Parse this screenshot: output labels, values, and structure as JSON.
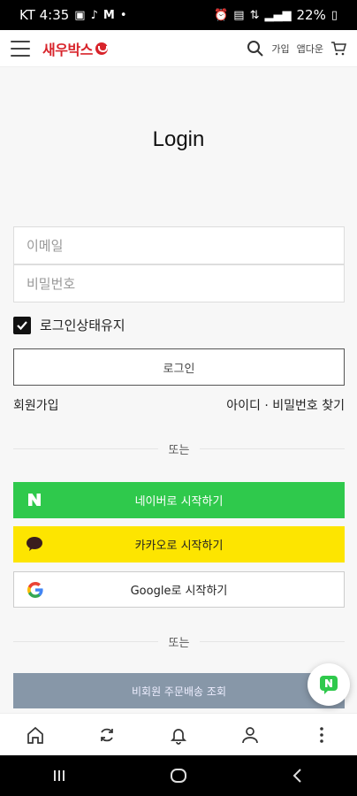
{
  "status_bar": {
    "time": "KT 4:35",
    "battery": "22%"
  },
  "header": {
    "logo_text": "새우박스",
    "join_label": "가입",
    "app_download_label": "앱다운",
    "brand_color": "#d8242b"
  },
  "main": {
    "title": "Login",
    "email_placeholder": "이메일",
    "password_placeholder": "비밀번호",
    "keep_login_label": "로그인상태유지",
    "keep_login_checked": true,
    "login_button": "로그인",
    "signup_link": "회원가입",
    "find_account_link": "아이디 · 비밀번호 찾기",
    "divider_text_1": "또는",
    "naver_button": "네이버로 시작하기",
    "kakao_button": "카카오로 시작하기",
    "google_button": "Google로 시작하기",
    "divider_text_2": "또는",
    "guest_order_button": "비회원 주문배송 조회"
  },
  "colors": {
    "naver": "#2fc94c",
    "kakao": "#fde500",
    "guest_button": "#8797a8"
  },
  "bottom_nav": {
    "items": [
      "home-icon",
      "refresh-icon",
      "bell-icon",
      "user-icon",
      "more-icon"
    ]
  }
}
